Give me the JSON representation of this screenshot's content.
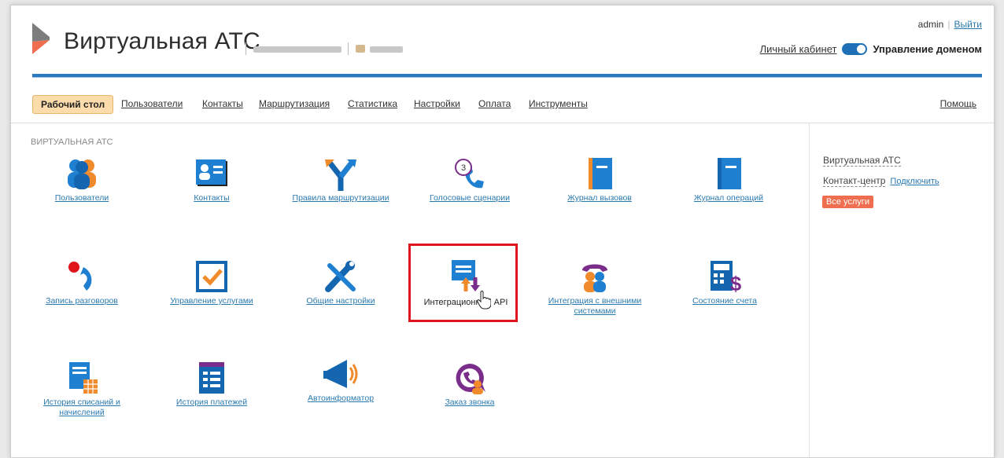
{
  "header": {
    "title": "Виртуальная АТС",
    "user": "admin",
    "logout": "Выйти",
    "cabinet_link": "Личный кабинет",
    "domain_mode": "Управление доменом"
  },
  "nav": {
    "active": "Рабочий стол",
    "items": [
      "Пользователи",
      "Контакты",
      "Маршрутизация",
      "Статистика",
      "Настройки",
      "Оплата",
      "Инструменты"
    ],
    "help": "Помощь"
  },
  "main": {
    "section_title": "ВИРТУАЛЬНАЯ АТС",
    "tiles": [
      {
        "label": "Пользователи",
        "icon": "users-icon"
      },
      {
        "label": "Контакты",
        "icon": "contacts-card-icon"
      },
      {
        "label": "Правила маршрутизации",
        "icon": "routing-arrows-icon"
      },
      {
        "label": "Голосовые сценарии",
        "icon": "voice-scenario-icon",
        "badge": "3"
      },
      {
        "label": "Журнал вызовов",
        "icon": "call-log-book-icon"
      },
      {
        "label": "Журнал операций",
        "icon": "operations-log-book-icon"
      },
      {
        "label": "Запись разговоров",
        "icon": "call-recording-icon"
      },
      {
        "label": "Управление услугами",
        "icon": "checkbox-icon"
      },
      {
        "label": "Общие настройки",
        "icon": "tools-icon"
      },
      {
        "label": "Интеграционный API",
        "icon": "api-document-icon"
      },
      {
        "label": "Интеграция с внешними системами",
        "icon": "external-integration-icon"
      },
      {
        "label": "Состояние счета",
        "icon": "calculator-dollar-icon"
      },
      {
        "label": "История списаний и начислений",
        "icon": "charges-history-icon"
      },
      {
        "label": "История платежей",
        "icon": "payments-history-icon"
      },
      {
        "label": "Автоинформатор",
        "icon": "megaphone-icon"
      },
      {
        "label": "Заказ звонка",
        "icon": "callback-order-icon"
      }
    ]
  },
  "sidebar": {
    "virtual_ats": "Виртуальная АТС",
    "contact_center": "Контакт-центр",
    "connect": "Подключить",
    "all_services": "Все услуги"
  },
  "colors": {
    "accent_blue": "#2b79bf",
    "link": "#2a7ab0",
    "active_tab_bg": "#fbdcaa",
    "highlight_red": "#e0151b",
    "badge_orange": "#ef6e4f"
  }
}
